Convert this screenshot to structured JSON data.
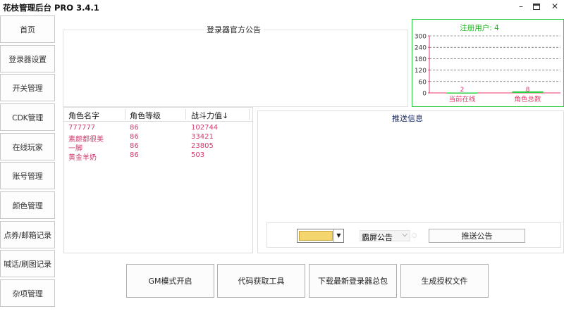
{
  "window": {
    "title": "花枝管理后台 PRO 3.4.1",
    "minimize": "–",
    "close": "✕"
  },
  "sidebar": {
    "items": [
      {
        "label": "首页"
      },
      {
        "label": "登录器设置"
      },
      {
        "label": "开关管理"
      },
      {
        "label": "CDK管理"
      },
      {
        "label": "在线玩家"
      },
      {
        "label": "账号管理"
      },
      {
        "label": "颜色管理"
      },
      {
        "label": "点券/邮箱记录"
      },
      {
        "label": "喊话/刷图记录"
      },
      {
        "label": "杂项管理"
      }
    ]
  },
  "notice": {
    "title": "登录器官方公告"
  },
  "stats": {
    "title": "注册用户: 4"
  },
  "chart_data": {
    "type": "bar",
    "title": "注册用户: 4",
    "categories": [
      "当前在线",
      "角色总数"
    ],
    "values": [
      2,
      8
    ],
    "ylim": [
      0,
      300
    ],
    "yticks": [
      "0",
      "60",
      "120",
      "180",
      "240",
      "300"
    ],
    "grid": "dashed horizontal",
    "colors": {
      "axis": "#e8396b",
      "bar": "#2ecc40",
      "grid": "#444444",
      "title": "#22b322"
    }
  },
  "roles": {
    "headers": [
      "角色名字",
      "角色等级",
      "战斗力值↓"
    ],
    "rows": [
      [
        "777777",
        "86",
        "102744"
      ],
      [
        "素颜都很美",
        "86",
        "33421"
      ],
      [
        "一脚",
        "86",
        "23805"
      ],
      [
        "黄金羊奶",
        "86",
        "503"
      ]
    ]
  },
  "push": {
    "title": "推送信息",
    "color": "#f5d66e",
    "type_value": "霸屏公告",
    "send_label": "推送公告"
  },
  "actions": {
    "gm_mode": "GM模式开启",
    "code_tool": "代码获取工具",
    "download": "下载最新登录器总包",
    "auth": "生成授权文件"
  }
}
